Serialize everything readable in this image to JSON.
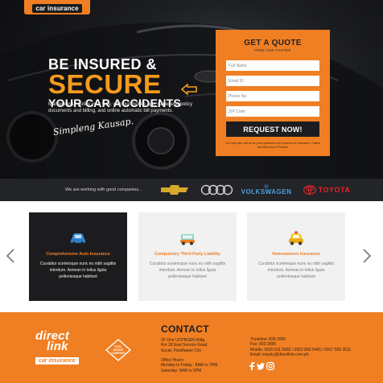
{
  "brand": {
    "top_logo_text": "car insurance"
  },
  "hero": {
    "line1": "BE INSURED &",
    "line2": "SECURE",
    "line3": "YOUR CAR ACCIDENTS",
    "body": "Manage your policy your way, with our mobile app, paperless policy documents and billing, and online automatic bill payments.",
    "tagline": "Simpleng Kausap."
  },
  "quote_form": {
    "title": "GET A QUOTE",
    "subtitle": "FREE AND FASTER",
    "fields": {
      "full_name": "Full Name",
      "email": "Email ID",
      "phone": "Phone No",
      "zip": "ZIP Code"
    },
    "button_label": "REQUEST NOW!",
    "note": "You may also call us for your questions and inquiries on Insurance, Claims and Renewal of Policies"
  },
  "partners": {
    "label": "We are working with good companies...",
    "brands": [
      "VOLKSWAGEN",
      "TOYOTA"
    ]
  },
  "products": [
    {
      "title": "Comprehensive Auto Insurance",
      "text": "Curabitur scelerisque nunc eu nibh sagittis interdum. Aenean in tellus ligula pellentesque habitant"
    },
    {
      "title": "Compulsory Third Party Liability",
      "text": "Curabitur scelerisque nunc eu nibh sagittis interdum. Aenean in tellus ligula pellentesque habitant"
    },
    {
      "title": "Homeowners Insurance",
      "text": "Curabitur scelerisque nunc eu nibh sagittis interdum. Aenean in tellus ligula pellentesque habitant"
    }
  ],
  "footer": {
    "logo_line1": "direct",
    "logo_line2": "link",
    "logo_line3": "car insurance",
    "badge_text": "PCSL GROUP COMPANY",
    "contact_title": "CONTACT",
    "address_1": "2F One UCPBGEN Bldg.",
    "address_2": "Km 18 East Service Road,",
    "address_3": "Sucat, Parañaque City",
    "hours_label": "Office Hours:",
    "hours_1": "Monday to Friday : 8AM to 7PM",
    "hours_2": "Saturday: 9AM to 5PM",
    "trunkline": "Trunkline: 828 2000",
    "fax": "Fax: 893 2589",
    "mobile": "Mobile: 0920 911 5582 / 0922 893 5465 / 0917 569 3511",
    "email": "Email: inquiry@directlink.com.ph"
  },
  "colors": {
    "accent": "#f07f23",
    "dark": "#1c1c1e",
    "hero_highlight": "#f59a1b"
  }
}
